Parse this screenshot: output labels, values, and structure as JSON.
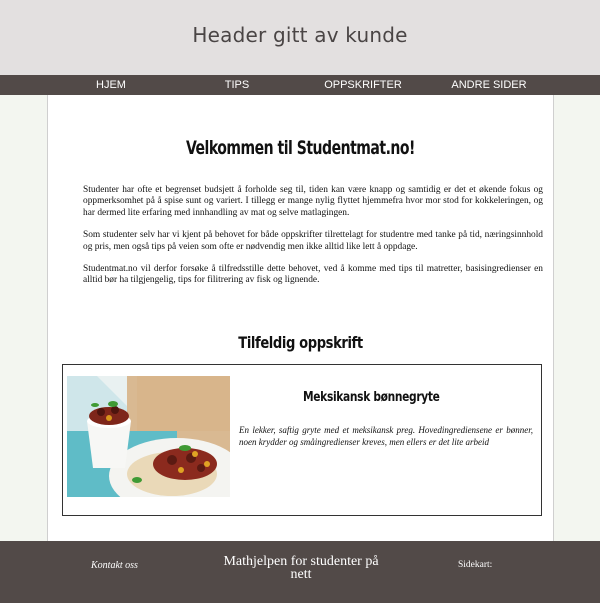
{
  "header": {
    "title": "Header gitt av kunde"
  },
  "nav": {
    "items": [
      {
        "label": "HJEM"
      },
      {
        "label": "TIPS"
      },
      {
        "label": "OPPSKRIFTER"
      },
      {
        "label": "ANDRE SIDER"
      }
    ]
  },
  "main": {
    "title": "Velkommen til Studentmat.no!",
    "paragraphs": [
      "Studenter har ofte et begrenset budsjett å forholde seg til, tiden kan være knapp og samtidig er det et økende fokus og oppmerksomhet på å spise sunt og variert. I tillegg er mange nylig flyttet hjemmefra hvor mor stod for kokkeleringen, og har dermed lite erfaring med innhandling av mat og selve matlagingen.",
      "Som studenter selv har vi kjent på behovet for både oppskrifter tilrettelagt for studentre med tanke på tid, næringsinnhold og pris, men også tips på veien som ofte er nødvendig men ikke alltid like lett å oppdage.",
      "Studentmat.no vil derfor forsøke å tilfredsstille dette behovet, ved å komme med tips til matretter, basisingredienser en alltid bør ha tilgjengelig, tips for filitrering av fisk og lignende."
    ],
    "random_recipe": {
      "heading": "Tilfeldig oppskrift",
      "name": "Meksikansk bønnegryte",
      "description": "En lekker, saftig gryte med et meksikansk preg. Hovedingrediensene er bønner, noen krydder og småingredienser kreves, men ellers er det lite arbeid"
    }
  },
  "footer": {
    "contact": "Kontakt oss",
    "tagline": "Mathjelpen for studenter på nett",
    "sitemap": "Sidekart:"
  },
  "colors": {
    "header_bg": "#e3e0e0",
    "nav_bg": "#524a48",
    "footer_bg": "#524a48",
    "page_bg": "#f3f6f0"
  }
}
